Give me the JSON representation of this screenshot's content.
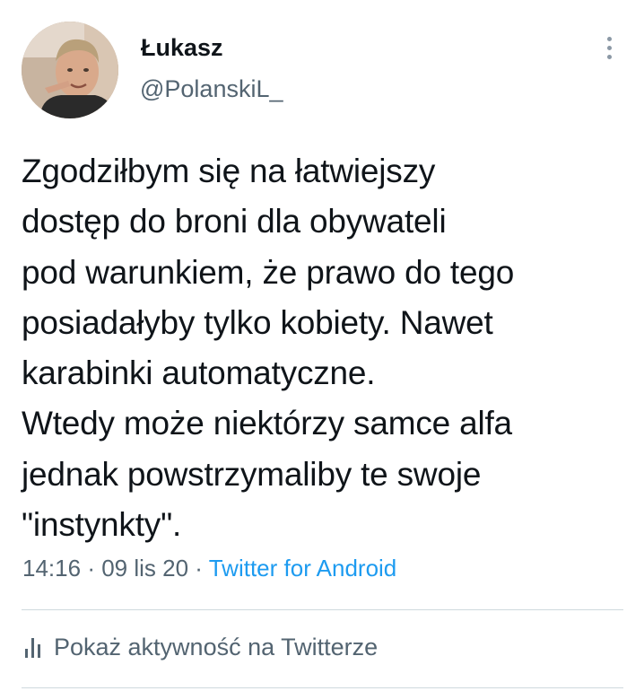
{
  "author": {
    "display_name": "Łukasz",
    "handle": "@PolanskiL_"
  },
  "tweet": {
    "lines": [
      "Zgodziłbym się na łatwiejszy",
      "dostęp do broni dla obywateli",
      "pod warunkiem, że prawo do tego",
      "posiadałyby tylko kobiety. Nawet",
      "karabinki automatyczne.",
      "Wtedy może niektórzy samce alfa",
      "jednak powstrzymaliby te swoje",
      "\"instynkty\"."
    ]
  },
  "meta": {
    "time": "14:16",
    "separator": "·",
    "date": "09 lis 20",
    "source": "Twitter for Android"
  },
  "activity": {
    "label": "Pokaż aktywność na Twitterze",
    "icon": "bar-chart-icon"
  },
  "colors": {
    "text": "#0f1419",
    "secondary": "#536471",
    "link": "#1d9bf0",
    "divider": "#cfd9de"
  }
}
